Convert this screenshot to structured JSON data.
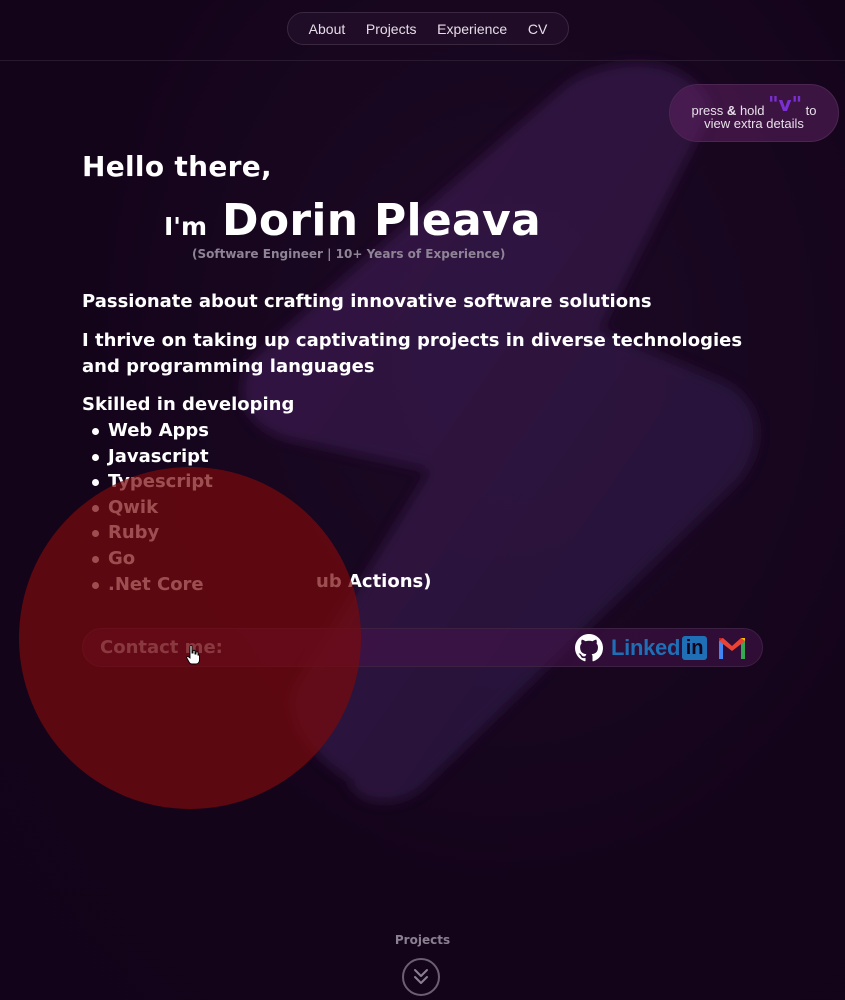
{
  "nav": {
    "items": [
      {
        "label": "About"
      },
      {
        "label": "Projects"
      },
      {
        "label": "Experience"
      },
      {
        "label": "CV"
      }
    ]
  },
  "hint": {
    "press": "press",
    "amp": "&",
    "hold": "hold",
    "key": "\"v\"",
    "to": "to",
    "line2": "view extra details"
  },
  "hero": {
    "greeting": "Hello there,",
    "im": "I'm",
    "name": "Dorin Pleava",
    "subtitle": "(Software Engineer | 10+ Years of Experience)",
    "line1": "Passionate about crafting innovative software solutions",
    "line2": "I thrive on taking up captivating projects in diverse technologies and programming languages",
    "skills_heading": "Skilled in developing",
    "skills": [
      "Web Apps",
      "Javascript",
      "Typescript",
      "Qwik",
      "Ruby",
      "Go",
      ".Net Core"
    ],
    "skills_tail": "ub Actions)"
  },
  "contact": {
    "label": "Contact me:",
    "linkedin_text": "Linked",
    "linkedin_box": "in",
    "icons": [
      "github-icon",
      "linkedin-icon",
      "gmail-icon"
    ]
  },
  "next_section": {
    "label": "Projects",
    "icon": "chevron-double-down-icon"
  },
  "colors": {
    "background": "#14041a",
    "accent": "#7a2fd0",
    "linkedin": "#1f6fb6",
    "overlay_red": "#780a0c"
  }
}
